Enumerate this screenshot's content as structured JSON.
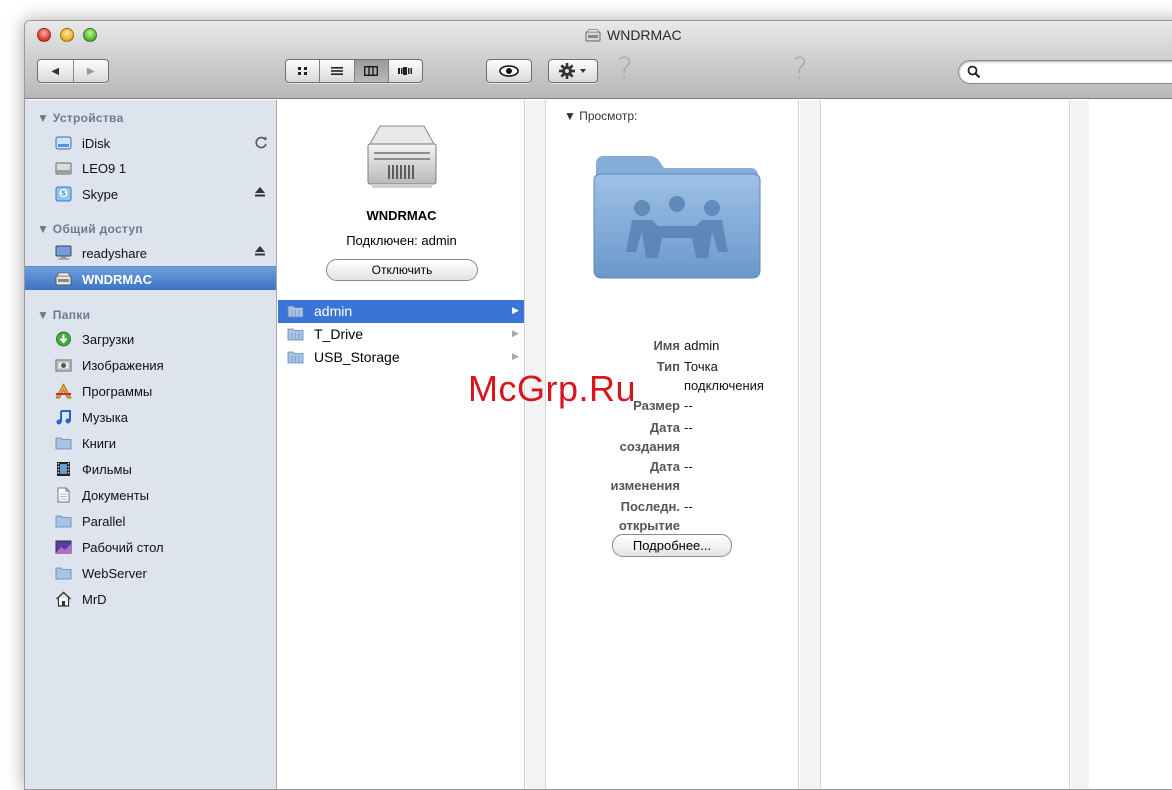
{
  "window": {
    "title": "WNDRMAC"
  },
  "toolbar": {
    "back": "◀",
    "forward": "▶",
    "help_glyph": "?",
    "search": {
      "placeholder": ""
    }
  },
  "sidebar": {
    "devices_header": "▼ Устройства",
    "devices": [
      {
        "label": "iDisk",
        "icon": "idisk-icon",
        "right": "sync-icon"
      },
      {
        "label": "LEO9 1",
        "icon": "hard-drive-icon"
      },
      {
        "label": "Skype",
        "icon": "disk-image-icon",
        "right": "eject-icon"
      }
    ],
    "shared_header": "▼ Общий доступ",
    "shared": [
      {
        "label": "readyshare",
        "icon": "network-computer-icon",
        "right": "eject-icon"
      },
      {
        "label": "WNDRMAC",
        "icon": "server-icon",
        "selected": true
      }
    ],
    "places_header": "▼ Папки",
    "places": [
      {
        "label": "Загрузки",
        "icon": "downloads-icon"
      },
      {
        "label": "Изображения",
        "icon": "pictures-icon"
      },
      {
        "label": "Программы",
        "icon": "applications-icon"
      },
      {
        "label": "Музыка",
        "icon": "music-icon"
      },
      {
        "label": "Книги",
        "icon": "folder-icon"
      },
      {
        "label": "Фильмы",
        "icon": "movies-icon"
      },
      {
        "label": "Документы",
        "icon": "documents-icon"
      },
      {
        "label": "Parallel",
        "icon": "folder-icon"
      },
      {
        "label": "Рабочий стол",
        "icon": "desktop-icon"
      },
      {
        "label": "WebServer",
        "icon": "folder-icon"
      },
      {
        "label": "MrD",
        "icon": "home-icon"
      }
    ]
  },
  "server": {
    "name": "WNDRMAC",
    "status": "Подключен: admin",
    "disconnect_label": "Отключить"
  },
  "folders": [
    {
      "label": "admin",
      "selected": true
    },
    {
      "label": "T_Drive"
    },
    {
      "label": "USB_Storage"
    }
  ],
  "preview": {
    "header": "▼ Просмотр:",
    "name_key": "Имя",
    "name_val": "admin",
    "type_key": "Тип",
    "type_val_1": "Точка",
    "type_val_2": "подключения",
    "size_key": "Размер",
    "size_val": "--",
    "created_key_1": "Дата",
    "created_key_2": "создания",
    "created_val": "--",
    "modified_key_1": "Дата",
    "modified_key_2": "изменения",
    "modified_val": "--",
    "opened_key_1": "Последн.",
    "opened_key_2": "открытие",
    "opened_val": "--",
    "more_label": "Подробнее..."
  },
  "watermark": "McGrp.Ru",
  "colors": {
    "selection": "#3875d7",
    "sidebar_bg": "#dde4ee",
    "watermark": "#d8141d"
  }
}
